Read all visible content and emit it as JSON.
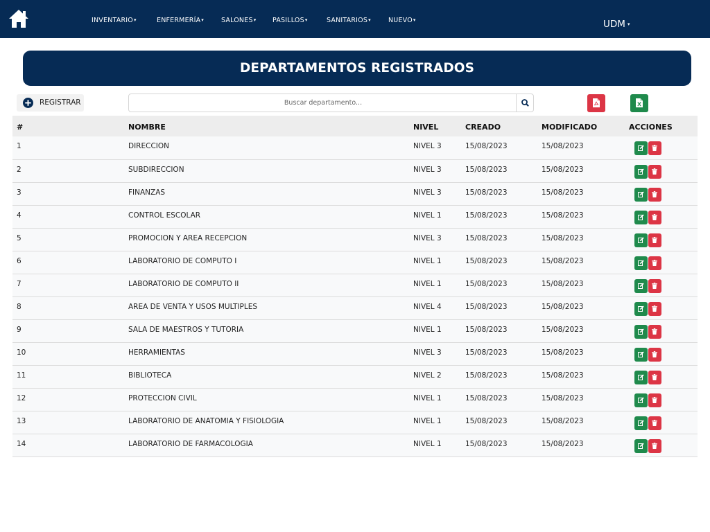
{
  "navbar": {
    "home_icon": "home-icon",
    "menu": [
      {
        "label": "INVENTARIO",
        "caret": "▾"
      },
      {
        "label": "ENFERMERÍA",
        "caret": "▾"
      },
      {
        "label": "SALONES",
        "caret": "▾"
      },
      {
        "label": "PASILLOS",
        "caret": "▾"
      },
      {
        "label": "SANITARIOS",
        "caret": "▾"
      },
      {
        "label": "NUEVO",
        "caret": "▾"
      }
    ],
    "user_label": "UDM",
    "user_caret": "▾"
  },
  "page_title": "DEPARTAMENTOS REGISTRADOS",
  "toolbar": {
    "register_label": "REGISTRAR",
    "register_icon": "plus-circle-icon",
    "search_placeholder": "Buscar departamento...",
    "search_icon": "search-icon",
    "pdf_icon": "pdf-file-icon",
    "excel_icon": "excel-file-icon"
  },
  "table": {
    "headers": {
      "id": "#",
      "name": "NOMBRE",
      "level": "NIVEL",
      "created": "CREADO",
      "modified": "MODIFICADO",
      "actions": "ACCIONES"
    },
    "rows": [
      {
        "id": "1",
        "name": "DIRECCION",
        "level": "NIVEL 3",
        "created": "15/08/2023",
        "modified": "15/08/2023"
      },
      {
        "id": "2",
        "name": "SUBDIRECCION",
        "level": "NIVEL 3",
        "created": "15/08/2023",
        "modified": "15/08/2023"
      },
      {
        "id": "3",
        "name": "FINANZAS",
        "level": "NIVEL 3",
        "created": "15/08/2023",
        "modified": "15/08/2023"
      },
      {
        "id": "4",
        "name": "CONTROL ESCOLAR",
        "level": "NIVEL 1",
        "created": "15/08/2023",
        "modified": "15/08/2023"
      },
      {
        "id": "5",
        "name": "PROMOCION Y AREA RECEPCION",
        "level": "NIVEL 3",
        "created": "15/08/2023",
        "modified": "15/08/2023"
      },
      {
        "id": "6",
        "name": "LABORATORIO DE COMPUTO I",
        "level": "NIVEL 1",
        "created": "15/08/2023",
        "modified": "15/08/2023"
      },
      {
        "id": "7",
        "name": "LABORATORIO DE COMPUTO II",
        "level": "NIVEL 1",
        "created": "15/08/2023",
        "modified": "15/08/2023"
      },
      {
        "id": "8",
        "name": "AREA DE VENTA Y USOS MULTIPLES",
        "level": "NIVEL 4",
        "created": "15/08/2023",
        "modified": "15/08/2023"
      },
      {
        "id": "9",
        "name": "SALA DE MAESTROS Y TUTORIA",
        "level": "NIVEL 1",
        "created": "15/08/2023",
        "modified": "15/08/2023"
      },
      {
        "id": "10",
        "name": "HERRAMIENTAS",
        "level": "NIVEL 3",
        "created": "15/08/2023",
        "modified": "15/08/2023"
      },
      {
        "id": "11",
        "name": "BIBLIOTECA",
        "level": "NIVEL 2",
        "created": "15/08/2023",
        "modified": "15/08/2023"
      },
      {
        "id": "12",
        "name": "PROTECCION CIVIL",
        "level": "NIVEL 1",
        "created": "15/08/2023",
        "modified": "15/08/2023"
      },
      {
        "id": "13",
        "name": "LABORATORIO DE ANATOMIA Y FISIOLOGIA",
        "level": "NIVEL 1",
        "created": "15/08/2023",
        "modified": "15/08/2023"
      },
      {
        "id": "14",
        "name": "LABORATORIO DE FARMACOLOGIA",
        "level": "NIVEL 1",
        "created": "15/08/2023",
        "modified": "15/08/2023"
      }
    ],
    "row_actions": {
      "edit_icon": "edit-icon",
      "delete_icon": "trash-icon"
    }
  },
  "colors": {
    "primary": "#062b55",
    "success": "#1f8a4c",
    "danger": "#dc3545",
    "header_bg": "#ededed",
    "row_bg": "#f8f9fa"
  }
}
